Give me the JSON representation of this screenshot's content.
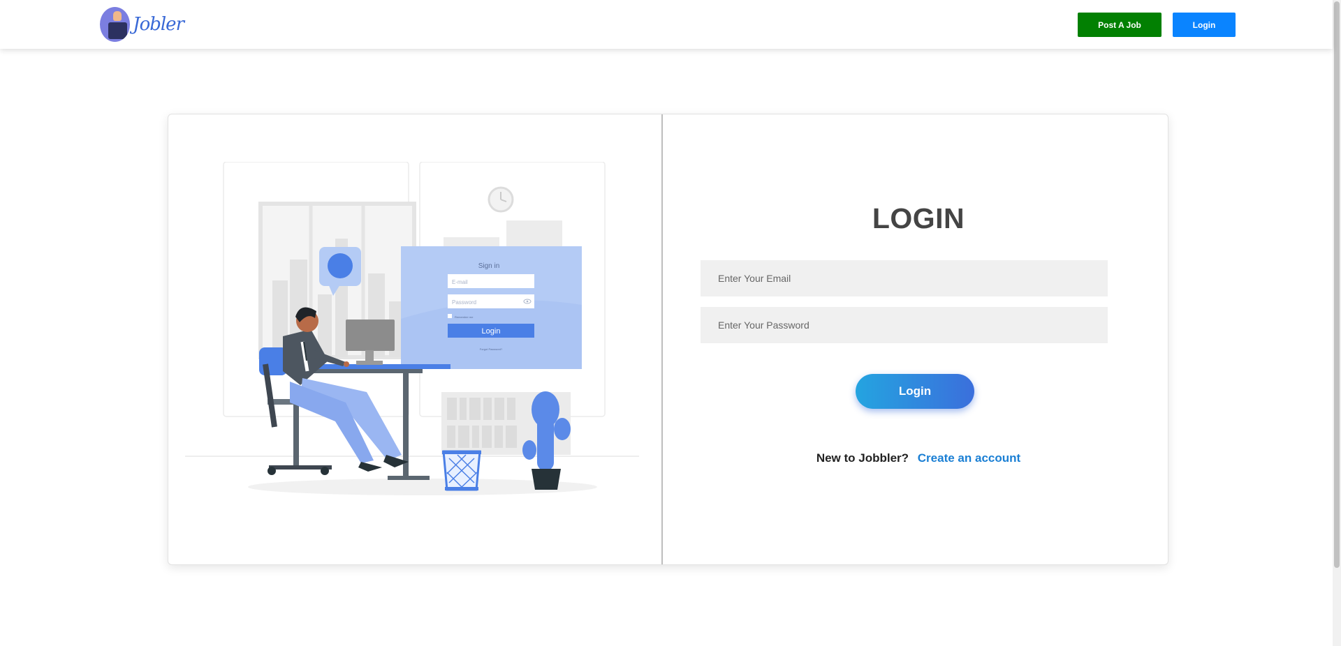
{
  "header": {
    "logo_text": "Jobler",
    "post_job_label": "Post A Job",
    "login_label": "Login"
  },
  "illustration": {
    "panel_title": "Sign in",
    "email_placeholder": "E-mail",
    "password_placeholder": "Password",
    "remember_label": "Remember me",
    "login_button": "Login",
    "forgot_link": "Forgot Password?"
  },
  "form": {
    "title": "LOGIN",
    "email_placeholder": "Enter Your Email",
    "password_placeholder": "Enter Your Password",
    "submit_label": "Login",
    "signup_question": "New to Jobbler?",
    "signup_link": "Create an account"
  },
  "colors": {
    "post_job_bg": "#028002",
    "nav_login_bg": "#0a84ff",
    "login_gradient_start": "#24a4e0",
    "login_gradient_end": "#3b6fdc",
    "link": "#1a7fd4",
    "illustration_accent": "#4a7fe6"
  },
  "icons": [
    "briefcase-logo-icon",
    "clock-icon",
    "user-avatar-icon",
    "eye-icon",
    "checkbox-icon",
    "cactus-icon",
    "wastebasket-icon"
  ]
}
